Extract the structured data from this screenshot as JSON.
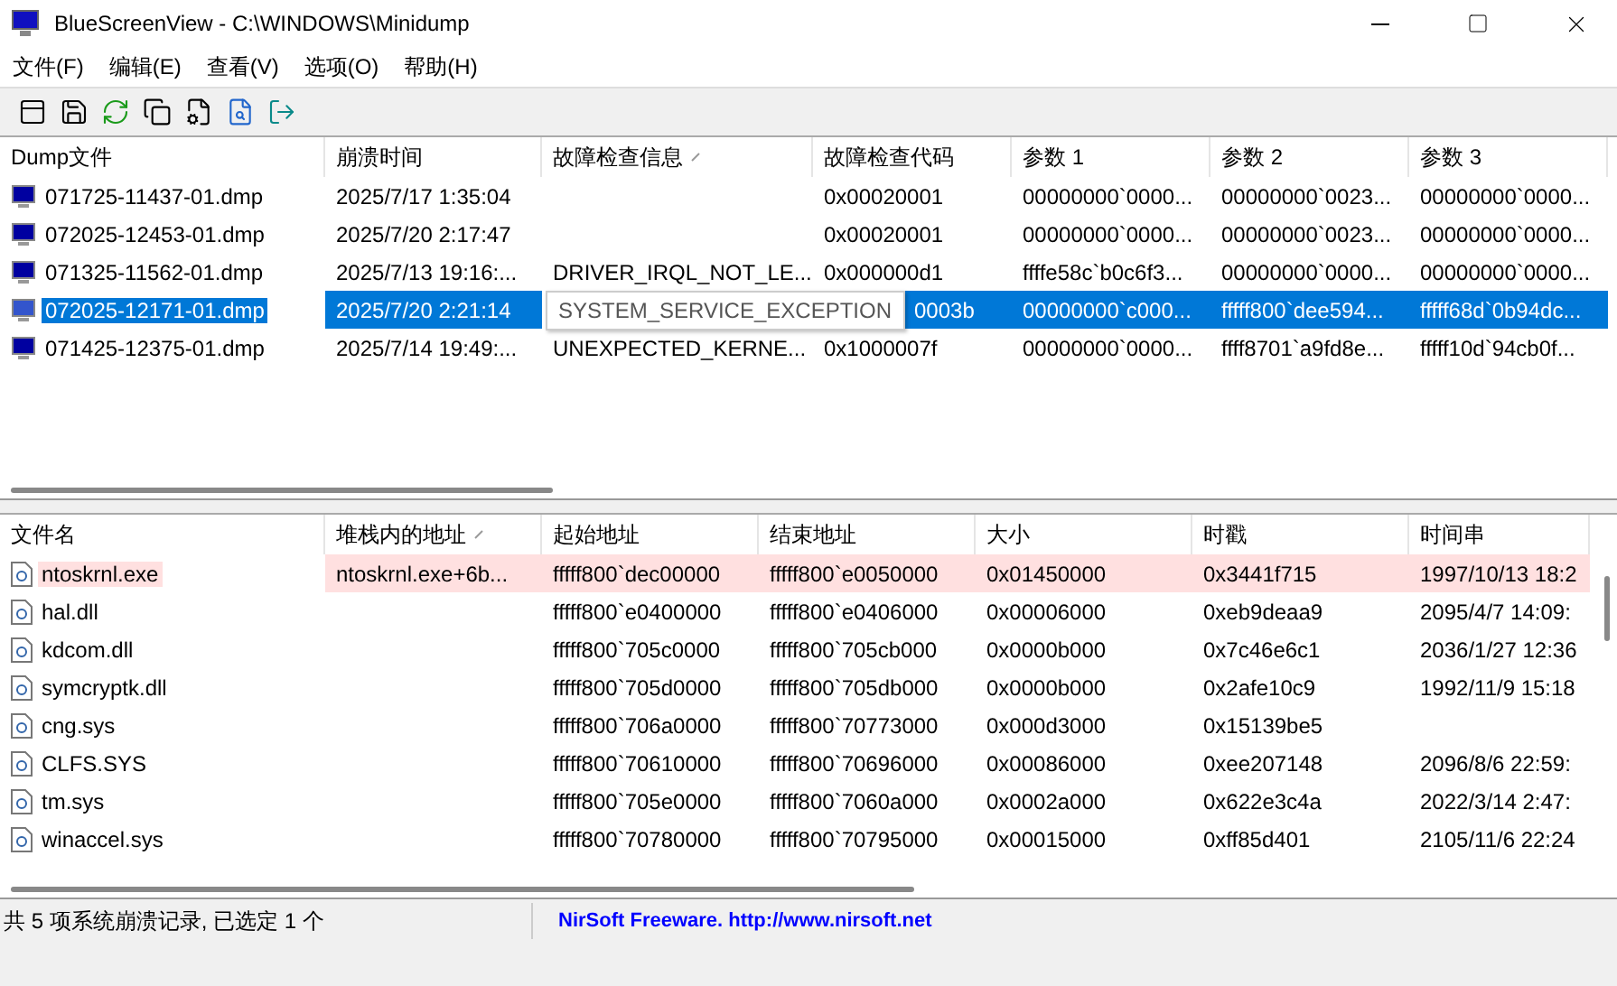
{
  "window": {
    "title": "BlueScreenView  -  C:\\WINDOWS\\Minidump"
  },
  "menu": [
    "文件(F)",
    "编辑(E)",
    "查看(V)",
    "选项(O)",
    "帮助(H)"
  ],
  "toolbar": [
    {
      "kind": "properties"
    },
    {
      "kind": "save"
    },
    {
      "kind": "refresh"
    },
    {
      "kind": "copy"
    },
    {
      "kind": "report"
    },
    {
      "kind": "search"
    },
    {
      "kind": "exit"
    }
  ],
  "dumps": {
    "columns": [
      {
        "label": "Dump文件",
        "sorted": false
      },
      {
        "label": "崩溃时间",
        "sorted": false
      },
      {
        "label": "故障检查信息",
        "sorted": true
      },
      {
        "label": "故障检查代码",
        "sorted": false
      },
      {
        "label": "参数 1",
        "sorted": false
      },
      {
        "label": "参数 2",
        "sorted": false
      },
      {
        "label": "参数 3",
        "sorted": false
      }
    ],
    "rows": [
      {
        "selected": false,
        "tooltip": false,
        "cells": [
          "071725-11437-01.dmp",
          "2025/7/17 1:35:04",
          "",
          "0x00020001",
          "00000000`0000...",
          "00000000`0023...",
          "00000000`0000..."
        ]
      },
      {
        "selected": false,
        "tooltip": false,
        "cells": [
          "072025-12453-01.dmp",
          "2025/7/20 2:17:47",
          "",
          "0x00020001",
          "00000000`0000...",
          "00000000`0023...",
          "00000000`0000..."
        ]
      },
      {
        "selected": false,
        "tooltip": false,
        "cells": [
          "071325-11562-01.dmp",
          "2025/7/13 19:16:...",
          "DRIVER_IRQL_NOT_LE...",
          "0x000000d1",
          "ffffe58c`b0c6f3...",
          "00000000`0000...",
          "00000000`0000..."
        ]
      },
      {
        "selected": true,
        "tooltip": true,
        "cells": [
          "072025-12171-01.dmp",
          "2025/7/20 2:21:14",
          "SYSTEM_SERVICE_EXCEPTION",
          "0003b",
          "00000000`c000...",
          "fffff800`dee594...",
          "fffff68d`0b94dc..."
        ]
      },
      {
        "selected": false,
        "tooltip": false,
        "cells": [
          "071425-12375-01.dmp",
          "2025/7/14 19:49:...",
          "UNEXPECTED_KERNE...",
          "0x1000007f",
          "00000000`0000...",
          "ffff8701`a9fd8e...",
          "fffff10d`94cb0f..."
        ]
      }
    ]
  },
  "drivers": {
    "columns": [
      {
        "label": "文件名",
        "sorted": false
      },
      {
        "label": "堆栈内的地址",
        "sorted": true
      },
      {
        "label": "起始地址",
        "sorted": false
      },
      {
        "label": "结束地址",
        "sorted": false
      },
      {
        "label": "大小",
        "sorted": false
      },
      {
        "label": "时戳",
        "sorted": false
      },
      {
        "label": "时间串",
        "sorted": false
      }
    ],
    "rows": [
      {
        "highlighted": true,
        "cells": [
          "ntoskrnl.exe",
          "ntoskrnl.exe+6b...",
          "fffff800`dec00000",
          "fffff800`e0050000",
          "0x01450000",
          "0x3441f715",
          "1997/10/13 18:2"
        ]
      },
      {
        "highlighted": false,
        "cells": [
          "hal.dll",
          "",
          "fffff800`e0400000",
          "fffff800`e0406000",
          "0x00006000",
          "0xeb9deaa9",
          "2095/4/7 14:09:"
        ]
      },
      {
        "highlighted": false,
        "cells": [
          "kdcom.dll",
          "",
          "fffff800`705c0000",
          "fffff800`705cb000",
          "0x0000b000",
          "0x7c46e6c1",
          "2036/1/27 12:36"
        ]
      },
      {
        "highlighted": false,
        "cells": [
          "symcryptk.dll",
          "",
          "fffff800`705d0000",
          "fffff800`705db000",
          "0x0000b000",
          "0x2afe10c9",
          "1992/11/9 15:18"
        ]
      },
      {
        "highlighted": false,
        "cells": [
          "cng.sys",
          "",
          "fffff800`706a0000",
          "fffff800`70773000",
          "0x000d3000",
          "0x15139be5",
          ""
        ]
      },
      {
        "highlighted": false,
        "cells": [
          "CLFS.SYS",
          "",
          "fffff800`70610000",
          "fffff800`70696000",
          "0x00086000",
          "0xee207148",
          "2096/8/6 22:59:"
        ]
      },
      {
        "highlighted": false,
        "cells": [
          "tm.sys",
          "",
          "fffff800`705e0000",
          "fffff800`7060a000",
          "0x0002a000",
          "0x622e3c4a",
          "2022/3/14 2:47:"
        ]
      },
      {
        "highlighted": false,
        "cells": [
          "winaccel.sys",
          "",
          "fffff800`70780000",
          "fffff800`70795000",
          "0x00015000",
          "0xff85d401",
          "2105/11/6 22:24"
        ]
      }
    ]
  },
  "status_bar": {
    "summary": "共 5 项系统崩溃记录, 已选定 1 个",
    "link": "NirSoft Freeware.  http://www.nirsoft.net"
  }
}
